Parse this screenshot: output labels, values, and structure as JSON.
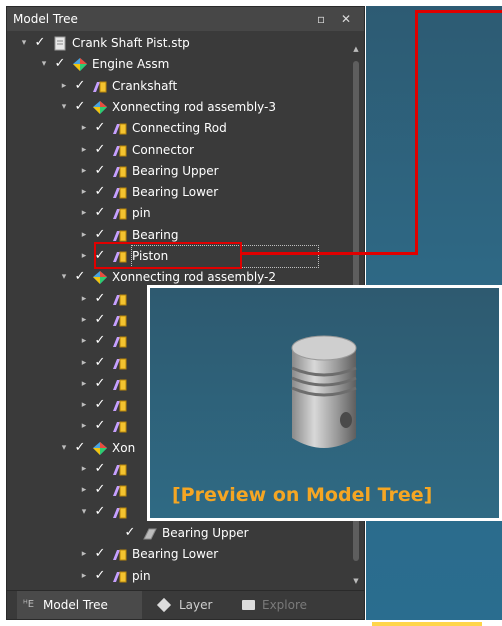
{
  "panel": {
    "title": "Model Tree",
    "restore_glyph": "▫",
    "close_glyph": "✕"
  },
  "tree": [
    {
      "label": "Crank Shaft Pist.stp",
      "icon": "document-icon",
      "expander": "▾",
      "checked": true
    },
    {
      "label": "Engine Assm",
      "icon": "assembly-icon",
      "expander": "▾",
      "checked": true
    },
    {
      "label": "Crankshaft",
      "icon": "part-icon",
      "expander": "▸",
      "checked": true
    },
    {
      "label": "Xonnecting rod assembly-3",
      "icon": "assembly-icon",
      "expander": "▾",
      "checked": true
    },
    {
      "label": "Connecting Rod",
      "icon": "part-icon",
      "expander": "▸",
      "checked": true
    },
    {
      "label": "Connector",
      "icon": "part-icon",
      "expander": "▸",
      "checked": true
    },
    {
      "label": "Bearing Upper",
      "icon": "part-icon",
      "expander": "▸",
      "checked": true
    },
    {
      "label": "Bearing Lower",
      "icon": "part-icon",
      "expander": "▸",
      "checked": true
    },
    {
      "label": "pin",
      "icon": "part-icon",
      "expander": "▸",
      "checked": true
    },
    {
      "label": "Bearing",
      "icon": "part-icon",
      "expander": "▸",
      "checked": true
    },
    {
      "label": "Piston",
      "icon": "part-icon",
      "expander": "▸",
      "checked": true,
      "selected": true
    },
    {
      "label": "Xonnecting rod assembly-2",
      "icon": "assembly-icon",
      "expander": "▾",
      "checked": true
    },
    {
      "label": "",
      "icon": "part-icon",
      "expander": "▸",
      "checked": true
    },
    {
      "label": "",
      "icon": "part-icon",
      "expander": "▸",
      "checked": true
    },
    {
      "label": "",
      "icon": "part-icon",
      "expander": "▸",
      "checked": true
    },
    {
      "label": "",
      "icon": "part-icon",
      "expander": "▸",
      "checked": true
    },
    {
      "label": "",
      "icon": "part-icon",
      "expander": "▸",
      "checked": true
    },
    {
      "label": "",
      "icon": "part-icon",
      "expander": "▸",
      "checked": true
    },
    {
      "label": "",
      "icon": "part-icon",
      "expander": "▸",
      "checked": true
    },
    {
      "label": "Xon",
      "icon": "assembly-icon",
      "expander": "▾",
      "checked": true
    },
    {
      "label": "",
      "icon": "part-icon",
      "expander": "▸",
      "checked": true
    },
    {
      "label": "",
      "icon": "part-icon",
      "expander": "▸",
      "checked": true
    },
    {
      "label": "",
      "icon": "part-icon",
      "expander": "▾",
      "checked": true
    },
    {
      "label": "Bearing Upper",
      "icon": "body-icon",
      "expander": "",
      "checked": true
    },
    {
      "label": "Bearing Lower",
      "icon": "part-icon",
      "expander": "▸",
      "checked": true
    },
    {
      "label": "pin",
      "icon": "part-icon",
      "expander": "▸",
      "checked": true
    }
  ],
  "tabs": [
    {
      "label": "Model Tree",
      "icon": "model-tree-icon",
      "active": true
    },
    {
      "label": "Layer",
      "icon": "layer-icon",
      "active": false
    },
    {
      "label": "Explore",
      "icon": "folder-icon",
      "active": false
    }
  ],
  "preview": {
    "caption": "[Preview on Model Tree]"
  },
  "colors": {
    "highlight": "#e00000",
    "caption": "#f5a623",
    "panel_bg": "#3a3a3a",
    "viewport": "#2e6a87"
  }
}
